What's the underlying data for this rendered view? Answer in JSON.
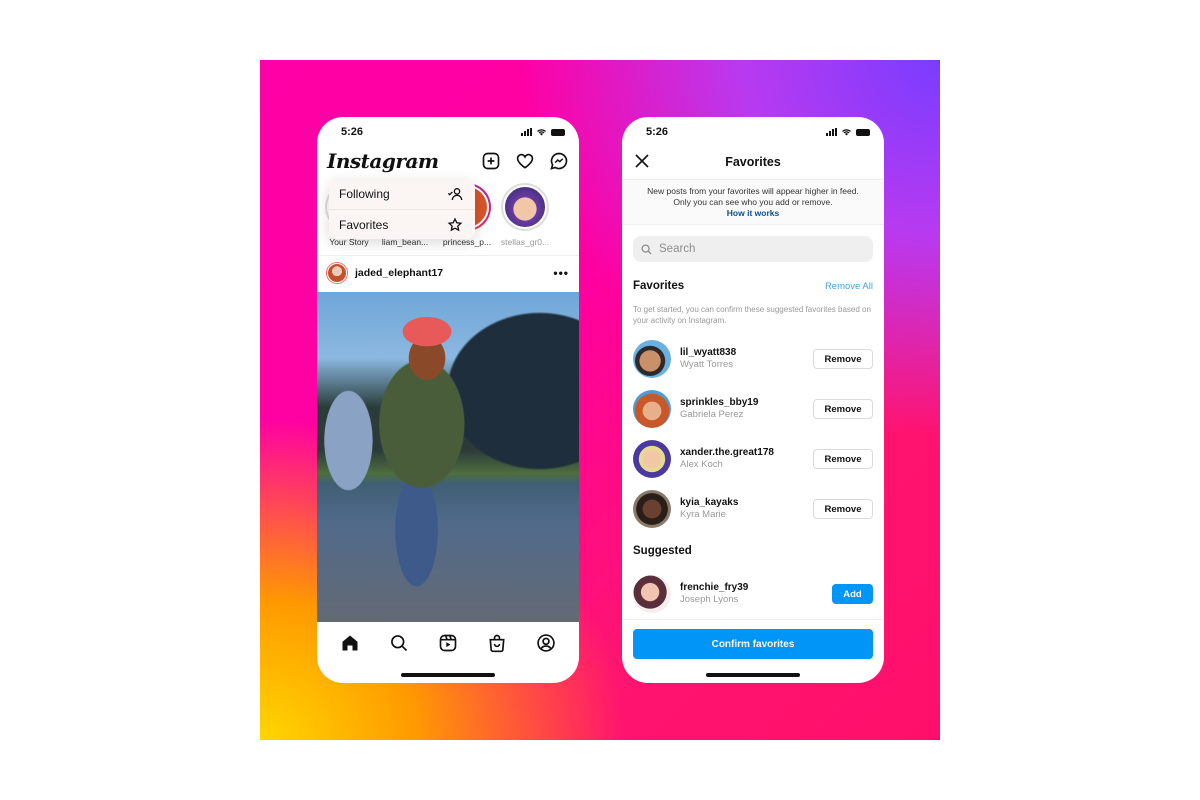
{
  "colors": {
    "gradient": [
      "#ffd600",
      "#ff9a00",
      "#ff00a6",
      "#ff1470",
      "#b83af0",
      "#7a3cff"
    ],
    "accent_blue": "#0095f6",
    "link_blue": "#4aa0d6"
  },
  "left_phone": {
    "status_time": "5:26",
    "logo": "Instagram",
    "header_icons": [
      "new-post-icon",
      "heart-icon",
      "messenger-icon"
    ],
    "dropdown": [
      {
        "label": "Following",
        "icon": "following-icon"
      },
      {
        "label": "Favorites",
        "icon": "star-icon"
      }
    ],
    "stories": [
      {
        "label": "Your Story"
      },
      {
        "label": "liam_bean..."
      },
      {
        "label": "princess_p..."
      },
      {
        "label": "stellas_gr0..."
      }
    ],
    "post": {
      "username": "jaded_elephant17",
      "more": "•••"
    },
    "tabbar": [
      "home-icon",
      "search-icon",
      "reels-icon",
      "shop-icon",
      "profile-icon"
    ]
  },
  "right_phone": {
    "status_time": "5:26",
    "title": "Favorites",
    "info_line1": "New posts from your favorites will appear higher in feed.",
    "info_line2": "Only you can see who you add or remove.",
    "how_it_works": "How it works",
    "search_placeholder": "Search",
    "favorites_title": "Favorites",
    "remove_all": "Remove All",
    "hint": "To get started, you can confirm these suggested favorites based on your activity on Instagram.",
    "favorites": [
      {
        "username": "lil_wyatt838",
        "name": "Wyatt Torres",
        "action": "Remove"
      },
      {
        "username": "sprinkles_bby19",
        "name": "Gabriela Perez",
        "action": "Remove"
      },
      {
        "username": "xander.the.great178",
        "name": "Alex Koch",
        "action": "Remove"
      },
      {
        "username": "kyia_kayaks",
        "name": "Kyra Marie",
        "action": "Remove"
      }
    ],
    "suggested_title": "Suggested",
    "suggested": [
      {
        "username": "frenchie_fry39",
        "name": "Joseph Lyons",
        "action": "Add"
      }
    ],
    "confirm_label": "Confirm favorites"
  }
}
